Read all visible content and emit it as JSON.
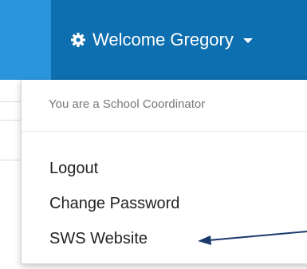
{
  "navbar": {
    "welcome_label": "Welcome Gregory",
    "user_icon": "gear-icon",
    "dropdown_icon": "caret-down-icon"
  },
  "dropdown": {
    "header": "You are a School Coordinator",
    "items": [
      {
        "label": "Logout"
      },
      {
        "label": "Change Password"
      },
      {
        "label": "SWS Website"
      }
    ]
  },
  "colors": {
    "navbar": "#1e86c8",
    "navbar_active": "#0e6fb0",
    "navbar_left": "#2a95dc",
    "arrow": "#1a3a6e"
  }
}
